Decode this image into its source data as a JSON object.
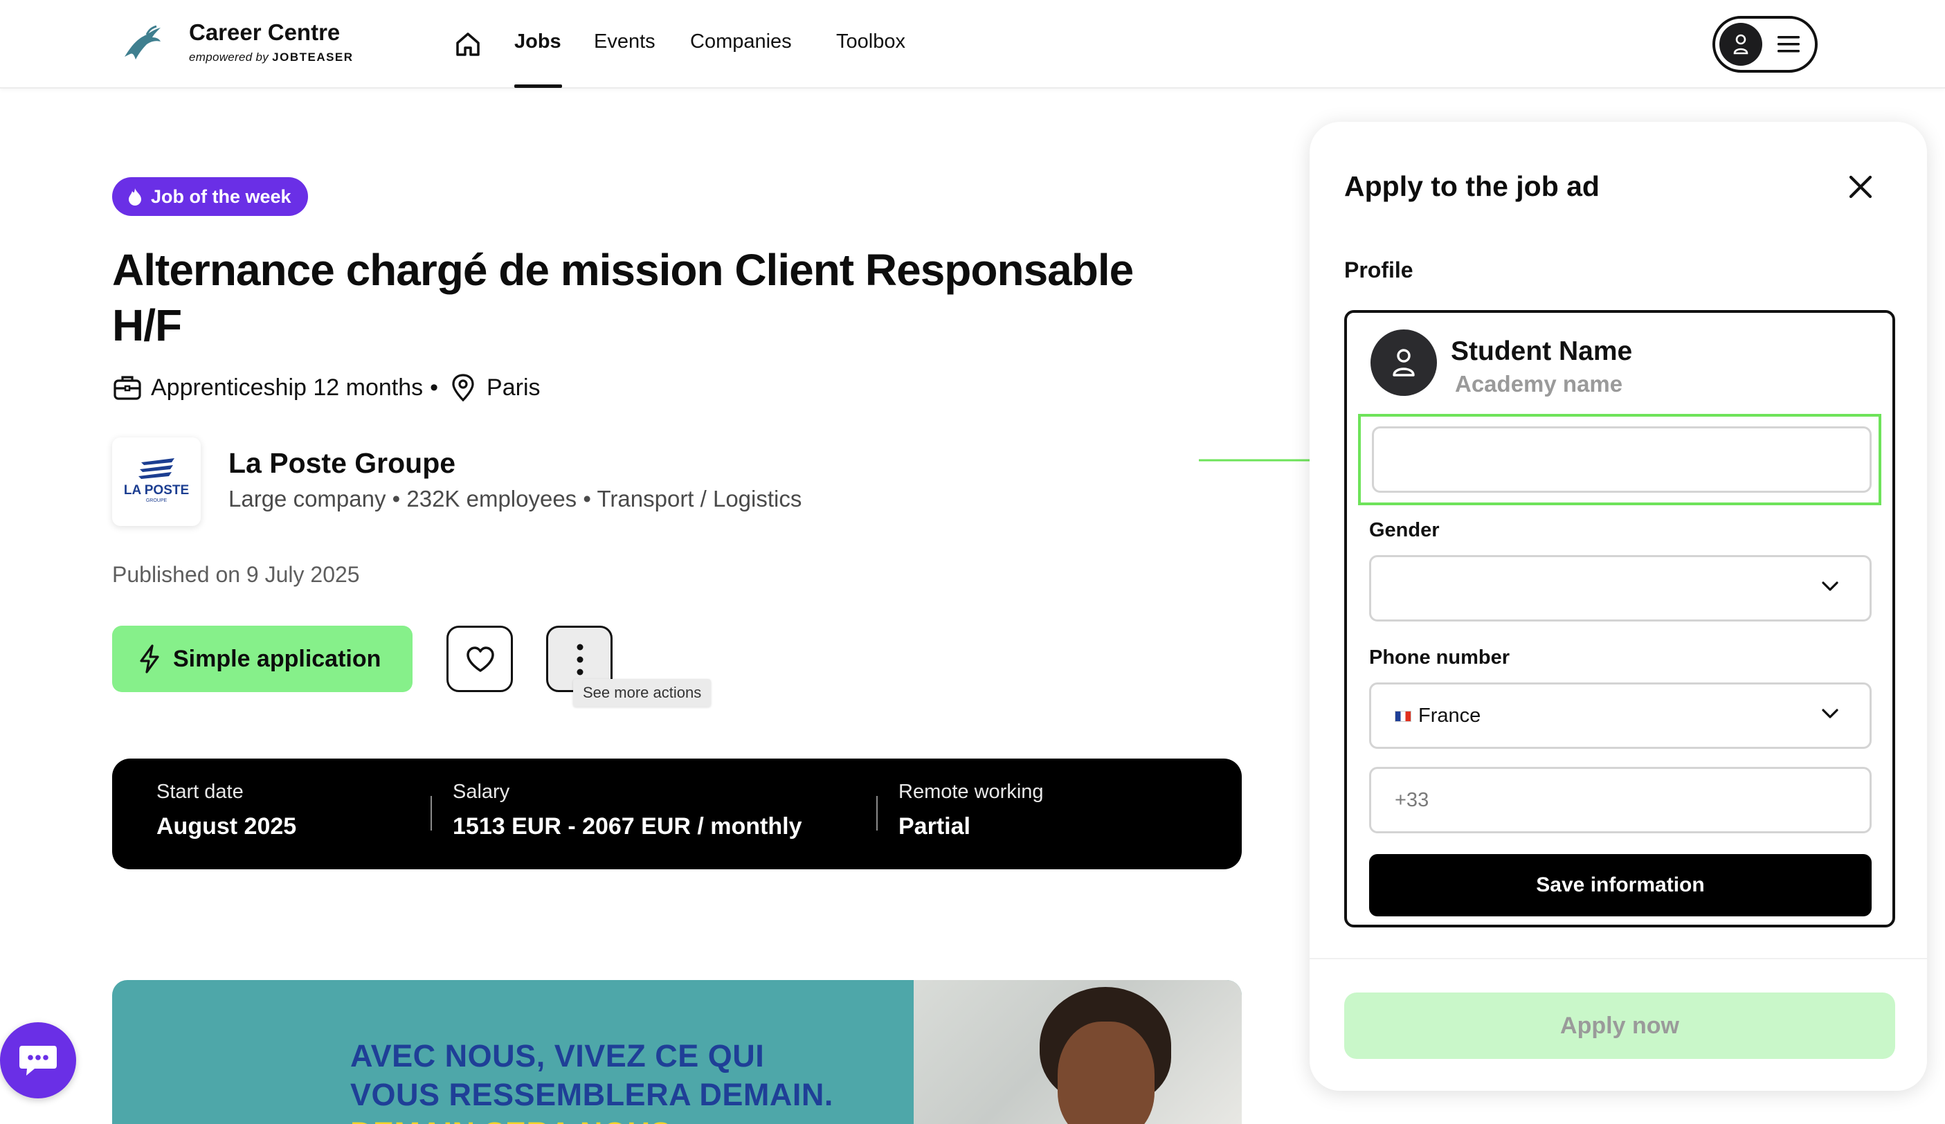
{
  "header": {
    "brand_title": "Career Centre",
    "brand_sub_prefix": "empowered by",
    "brand_sub_name": "JOBTEASER",
    "nav": [
      "Jobs",
      "Events",
      "Companies",
      "Toolbox"
    ],
    "active_nav": "Jobs"
  },
  "job": {
    "badge": "Job of the week",
    "title": "Alternance chargé de mission Client Responsable H/F",
    "contract": "Apprenticeship 12 months",
    "separator": "•",
    "location": "Paris",
    "published": "Published on 9 July 2025"
  },
  "company": {
    "logo_text": "LA POSTE",
    "logo_sub": "GROUPE",
    "name": "La Poste Groupe",
    "info": "Large company • 232K employees • Transport / Logistics"
  },
  "actions": {
    "apply": "Simple application",
    "tooltip": "See more actions"
  },
  "info_bar": [
    {
      "label": "Start date",
      "value": "August 2025"
    },
    {
      "label": "Salary",
      "value": "1513 EUR - 2067 EUR / monthly"
    },
    {
      "label": "Remote working",
      "value": "Partial"
    }
  ],
  "banner": {
    "line1": "AVEC NOUS, VIVEZ CE QUI",
    "line2": "VOUS RESSEMBLERA DEMAIN.",
    "line3": "DEMAIN SERA NOUS"
  },
  "panel": {
    "title": "Apply to the job ad",
    "profile_label": "Profile",
    "student_name": "Student Name",
    "academy_name": "Academy name",
    "empty_field_value": "",
    "gender_label": "Gender",
    "gender_value": "",
    "phone_label": "Phone number",
    "country": "France",
    "phone_placeholder": "+33",
    "save_button": "Save information",
    "apply_now": "Apply now"
  },
  "colors": {
    "accent_purple": "#6a2fe6",
    "apply_green": "#86f08a",
    "highlight_green": "#6ee35a",
    "brand_blue": "#1f3f97",
    "banner_teal": "#4ea7a9"
  }
}
